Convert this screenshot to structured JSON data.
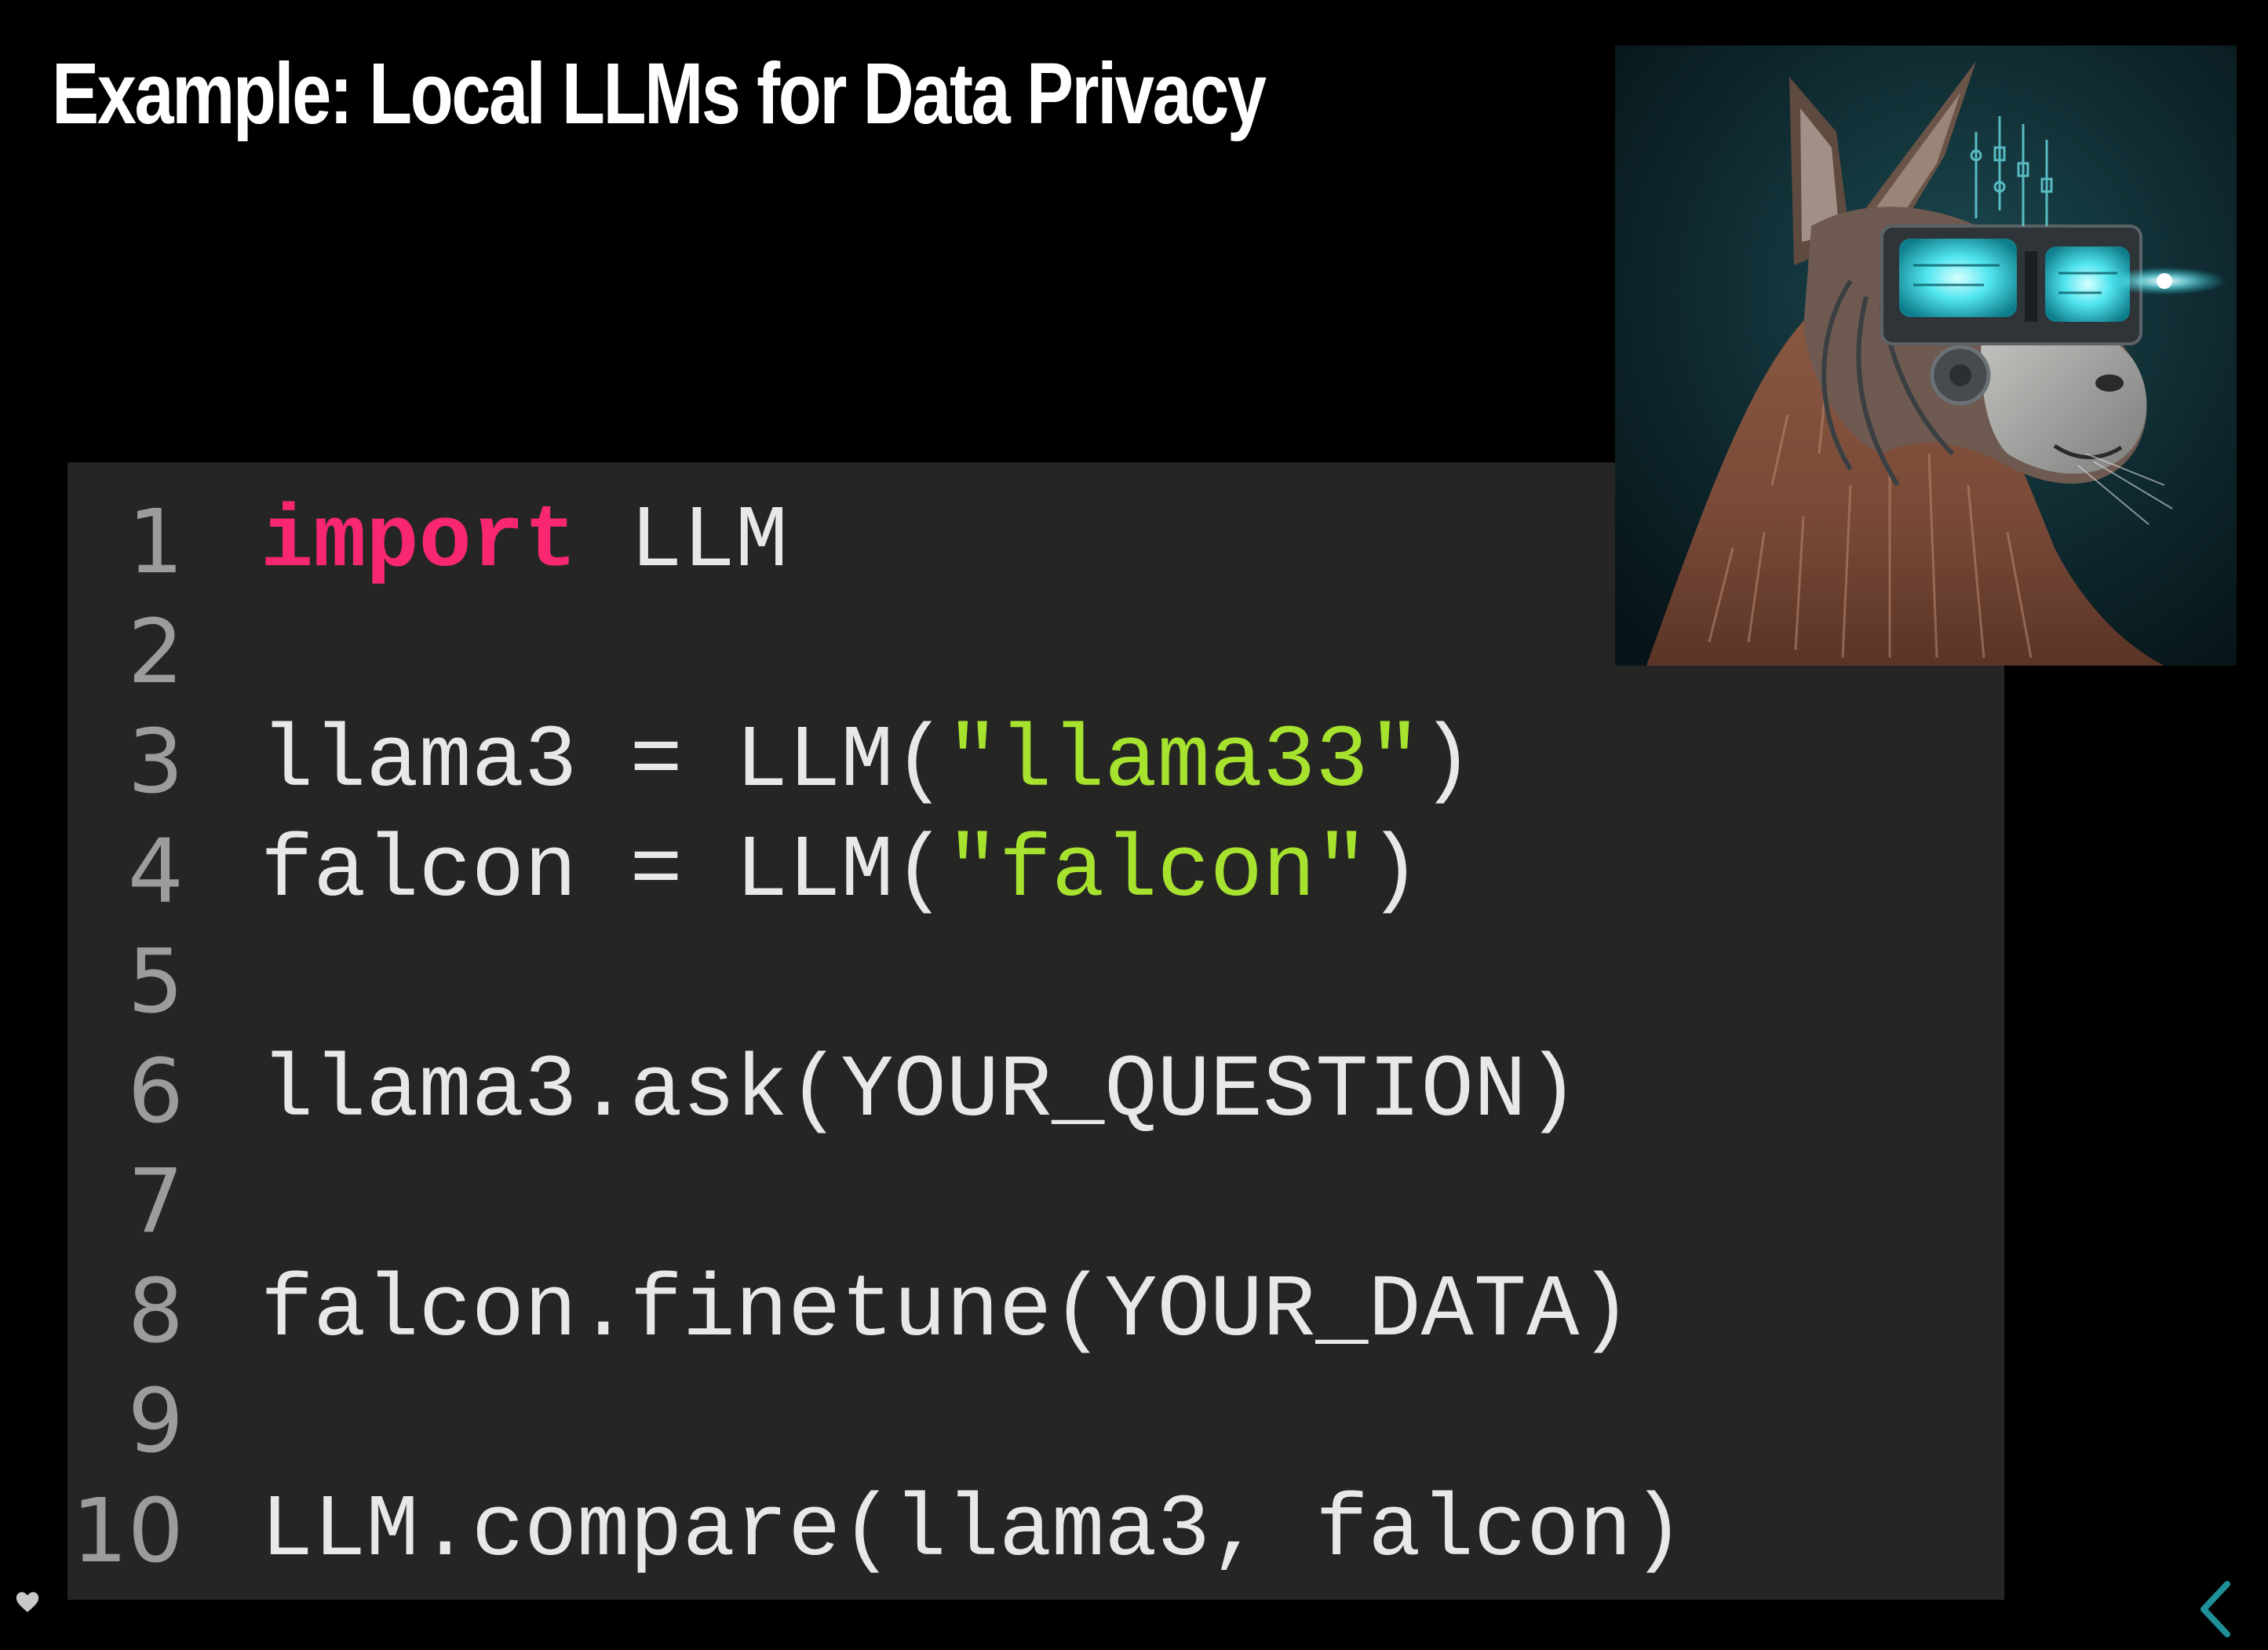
{
  "slide": {
    "title": "Example: Local LLMs for Data Privacy"
  },
  "code": {
    "lines": [
      {
        "number": "1",
        "tokens": [
          {
            "text": "import",
            "type": "keyword"
          },
          {
            "text": " LLM",
            "type": "plain"
          }
        ]
      },
      {
        "number": "2",
        "tokens": []
      },
      {
        "number": "3",
        "tokens": [
          {
            "text": "llama3 = LLM(",
            "type": "plain"
          },
          {
            "text": "\"llama33\"",
            "type": "string"
          },
          {
            "text": ")",
            "type": "plain"
          }
        ]
      },
      {
        "number": "4",
        "tokens": [
          {
            "text": "falcon = LLM(",
            "type": "plain"
          },
          {
            "text": "\"falcon\"",
            "type": "string"
          },
          {
            "text": ")",
            "type": "plain"
          }
        ]
      },
      {
        "number": "5",
        "tokens": []
      },
      {
        "number": "6",
        "tokens": [
          {
            "text": "llama3.ask(YOUR_QUESTION)",
            "type": "plain"
          }
        ]
      },
      {
        "number": "7",
        "tokens": []
      },
      {
        "number": "8",
        "tokens": [
          {
            "text": "falcon.finetune(YOUR_DATA)",
            "type": "plain"
          }
        ]
      },
      {
        "number": "9",
        "tokens": []
      },
      {
        "number": "10",
        "tokens": [
          {
            "text": "LLM.compare(llama3, falcon)",
            "type": "plain"
          }
        ]
      }
    ]
  },
  "image": {
    "name": "cyberpunk-llama-illustration"
  },
  "icons": {
    "heart": "heart-icon",
    "previous": "chevron-left-icon"
  },
  "colors": {
    "background": "#000000",
    "code_background": "#252623",
    "code_text": "#e8e8e6",
    "line_number": "#9c9c9a",
    "keyword": "#f92672",
    "string": "#a6e22e",
    "nav_accent": "#1f8f98"
  }
}
